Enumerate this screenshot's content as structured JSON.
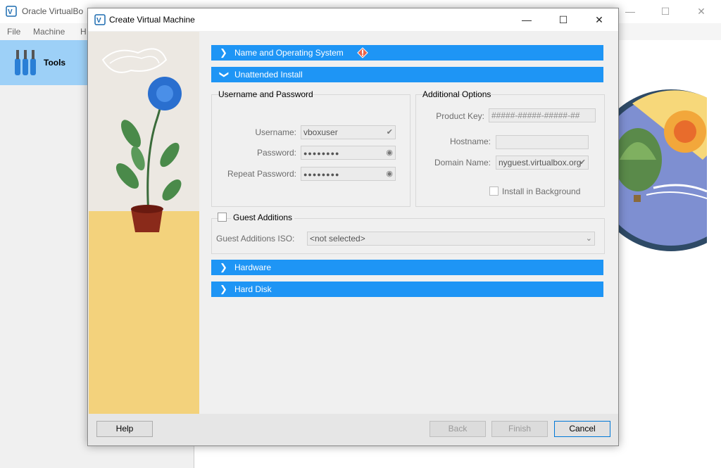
{
  "background_window": {
    "title": "Oracle VirtualBo",
    "menu": [
      "File",
      "Machine",
      "H"
    ],
    "tools_label": "Tools"
  },
  "dialog": {
    "title": "Create Virtual Machine",
    "sections": {
      "name_os": "Name and Operating System",
      "unattended": "Unattended Install",
      "hardware": "Hardware",
      "hard_disk": "Hard Disk"
    },
    "user_group": {
      "title": "Username and Password",
      "username_label": "Username:",
      "username_value": "vboxuser",
      "password_label": "Password:",
      "password_value": "●●●●●●●●",
      "repeat_label": "Repeat Password:",
      "repeat_value": "●●●●●●●●"
    },
    "options_group": {
      "title": "Additional Options",
      "product_key_label": "Product Key:",
      "product_key_placeholder": "#####-#####-#####-##",
      "hostname_label": "Hostname:",
      "hostname_value": "",
      "domain_label": "Domain Name:",
      "domain_value": "nyguest.virtualbox.org",
      "install_bg_label": "Install in Background"
    },
    "guest_additions": {
      "title": "Guest Additions",
      "iso_label": "Guest Additions ISO:",
      "iso_value": "<not selected>"
    },
    "buttons": {
      "help": "Help",
      "back": "Back",
      "finish": "Finish",
      "cancel": "Cancel"
    }
  },
  "colors": {
    "section_bar": "#1e95f5",
    "tools_highlight": "#9dd0f7",
    "warning_icon": "#e8634a"
  }
}
